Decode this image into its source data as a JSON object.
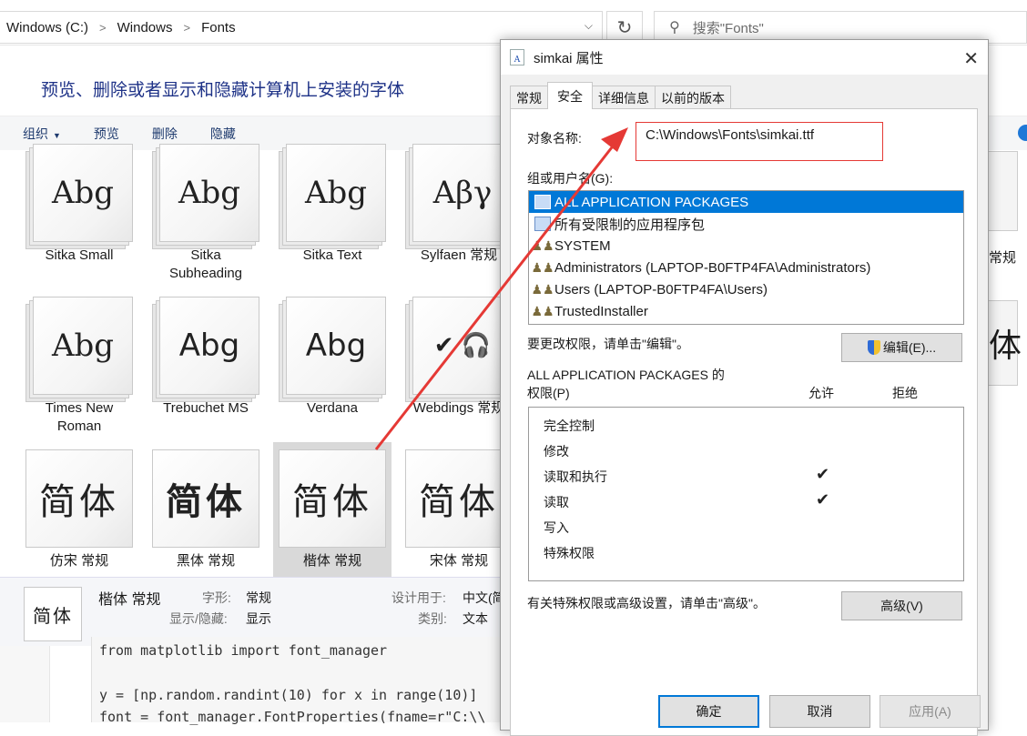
{
  "explorer": {
    "breadcrumb": [
      "Windows (C:)",
      "Windows",
      "Fonts"
    ],
    "search_placeholder": "搜索\"Fonts\"",
    "heading": "预览、删除或者显示和隐藏计算机上安装的字体",
    "toolbar": {
      "organize": "组织",
      "preview": "预览",
      "delete": "删除",
      "hide": "隐藏"
    },
    "fonts": [
      {
        "name": "Sitka Small",
        "sample": "Abg"
      },
      {
        "name": "Sitka Subheading",
        "sample": "Abg"
      },
      {
        "name": "Sitka Text",
        "sample": "Abg"
      },
      {
        "name": "Sylfaen 常规",
        "sample": "Αβγ"
      },
      {
        "name": "Times New Roman",
        "sample": "Abg"
      },
      {
        "name": "Trebuchet MS",
        "sample": "Abg"
      },
      {
        "name": "Verdana",
        "sample": "Abg"
      },
      {
        "name": "Webdings 常规",
        "sample": "✔ 🎧"
      },
      {
        "name": "仿宋 常规",
        "sample": "简体"
      },
      {
        "name": "黑体 常规",
        "sample": "简体"
      },
      {
        "name": "楷体 常规",
        "sample": "简体"
      },
      {
        "name": "宋体 常规",
        "sample": "简体"
      }
    ],
    "partial_right": {
      "label": "常规",
      "sample": "体"
    },
    "details": {
      "icon_text": "简体",
      "name": "楷体 常规",
      "style_label": "字形:",
      "style_value": "常规",
      "show_label": "显示/隐藏:",
      "show_value": "显示",
      "designed_label": "设计用于:",
      "designed_value": "中文(简",
      "category_label": "类别:",
      "category_value": "文本"
    }
  },
  "code": {
    "lines": [
      "from matplotlib import font_manager",
      "y = [np.random.randint(10) for x in range(10)]",
      "font = font_manager.FontProperties(fname=r\"C:\\\\"
    ]
  },
  "dialog": {
    "title": "simkai 属性",
    "tabs": [
      "常规",
      "安全",
      "详细信息",
      "以前的版本"
    ],
    "active_tab": "安全",
    "object_label": "对象名称:",
    "object_value": "C:\\Windows\\Fonts\\simkai.ttf",
    "groups_label": "组或用户名(G):",
    "users": [
      {
        "name": "ALL APPLICATION PACKAGES",
        "icon": "package-icon",
        "selected": true
      },
      {
        "name": "所有受限制的应用程序包",
        "icon": "package-icon",
        "selected": false
      },
      {
        "name": "SYSTEM",
        "icon": "group-icon",
        "selected": false
      },
      {
        "name": "Administrators (LAPTOP-B0FTP4FA\\Administrators)",
        "icon": "group-icon",
        "selected": false
      },
      {
        "name": "Users (LAPTOP-B0FTP4FA\\Users)",
        "icon": "group-icon",
        "selected": false
      },
      {
        "name": "TrustedInstaller",
        "icon": "group-icon",
        "selected": false
      }
    ],
    "change_perm_text": "要更改权限，请单击\"编辑\"。",
    "edit_button": "编辑(E)...",
    "perm_title_line1": "ALL APPLICATION PACKAGES 的",
    "perm_title_line2": "权限(P)",
    "allow_header": "允许",
    "deny_header": "拒绝",
    "permissions": [
      {
        "name": "完全控制",
        "allow": false
      },
      {
        "name": "修改",
        "allow": false
      },
      {
        "name": "读取和执行",
        "allow": true
      },
      {
        "name": "读取",
        "allow": true
      },
      {
        "name": "写入",
        "allow": false
      },
      {
        "name": "特殊权限",
        "allow": false
      }
    ],
    "advanced_text": "有关特殊权限或高级设置，请单击\"高级\"。",
    "advanced_button": "高级(V)",
    "ok_button": "确定",
    "cancel_button": "取消",
    "apply_button": "应用(A)"
  },
  "colors": {
    "accent": "#0078d7",
    "heading": "#1e3287",
    "highlight_red": "#e53935"
  }
}
